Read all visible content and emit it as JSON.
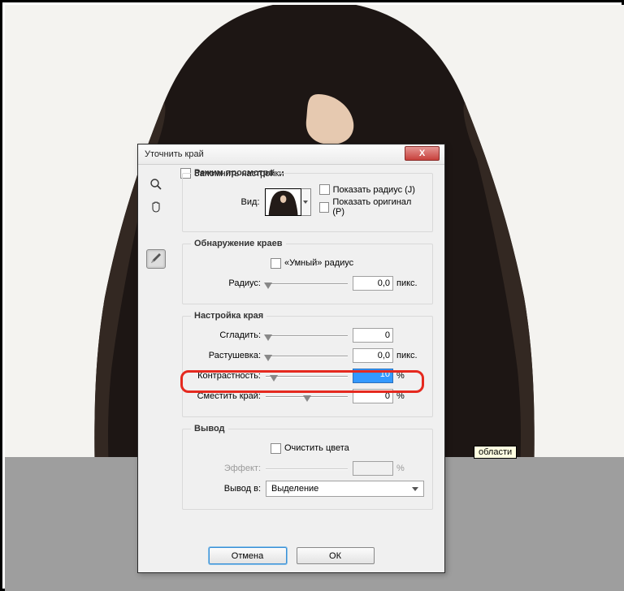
{
  "window": {
    "title": "Уточнить край"
  },
  "viewmode": {
    "legend": "Режим просмотра",
    "view_label": "Вид:",
    "show_radius": "Показать радиус (J)",
    "show_original": "Показать оригинал (P)"
  },
  "edges": {
    "legend": "Обнаружение краев",
    "smart_radius": "«Умный» радиус",
    "radius_label": "Радиус:",
    "radius_value": "0,0",
    "radius_unit": "пикс."
  },
  "adjust": {
    "legend": "Настройка края",
    "smooth_label": "Сгладить:",
    "smooth_value": "0",
    "feather_label": "Растушевка:",
    "feather_value": "0,0",
    "feather_unit": "пикс.",
    "contrast_label": "Контрастность:",
    "contrast_value": "10",
    "contrast_unit": "%",
    "shift_label": "Сместить край:",
    "shift_value": "0",
    "shift_unit": "%"
  },
  "output": {
    "legend": "Вывод",
    "decontaminate": "Очистить цвета",
    "effect_label": "Эффект:",
    "effect_value": "",
    "effect_unit": "%",
    "output_label": "Вывод в:",
    "output_value": "Выделение"
  },
  "remember": "Запомнить настройки",
  "buttons": {
    "cancel": "Отмена",
    "ok": "ОК"
  },
  "tooltip": "области"
}
